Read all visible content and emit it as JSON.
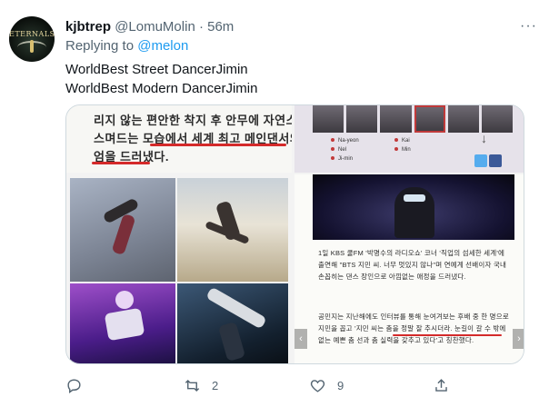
{
  "tweet": {
    "author_name": "kjbtrep",
    "handle": "@LomuMolin",
    "separator": "·",
    "time": "56m",
    "more": "···",
    "replying_prefix": "Replying to",
    "replying_mention": "@melon",
    "lines": [
      "WorldBest Street DancerJimin",
      "WorldBest Modern DancerJimin"
    ]
  },
  "avatar": {
    "wordmark": "ETERNALS"
  },
  "media": {
    "top_left": {
      "lines": [
        "리지 않는 편안한 착지 후 안무에 자연스럽게",
        "스며드는 모습에서 세계 최고 메인댄서의 위",
        "엄을 드러냈다."
      ]
    },
    "top_right": {
      "labels": [
        "Na-yeon",
        "Kai",
        "Nel",
        "Min",
        "Ji-min"
      ]
    },
    "bottom_right": {
      "paragraph_1": "1일 KBS 쿨FM '박명수의 라디오쇼' 코너 '직업의 섬세한 세계'에 출연해 \"BTS 지민 씨. 너무 멋있지 않나\"며 연예계 선배이자 국내 손꼽히는 댄스 장인으로 아낌없는 애정을 드러냈다.",
      "paragraph_2": "공민지는 지난해에도 인터뷰를 통해 눈여겨보는 후배 중 한 명으로 지민을 꼽고 '지민 씨는 춤을 정말 잘 추시더라. 눈길이 갈 수 밖에 없는 예쁜 춤 선과 춤 실력을 갖추고 있다'고 칭찬했다."
    }
  },
  "actions": {
    "reply_count": "",
    "retweet_count": "2",
    "like_count": "9"
  },
  "colors": {
    "accent": "#1d9bf0",
    "muted": "#536471",
    "underline": "#d42a2a"
  }
}
